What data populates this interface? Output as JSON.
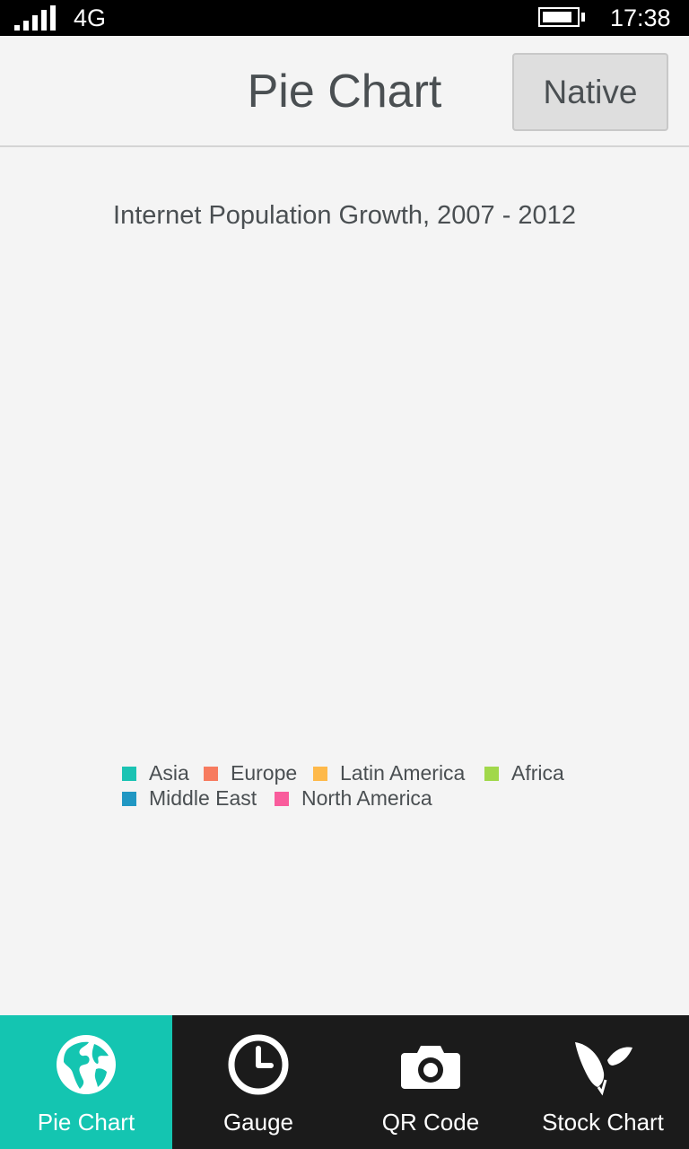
{
  "status_bar": {
    "network": "4G",
    "time": "17:38",
    "signal_bars": 5,
    "battery_level": 0.75
  },
  "header": {
    "title": "Pie Chart",
    "native_button": "Native"
  },
  "chart_data": {
    "type": "pie",
    "title": "Internet Population Growth, 2007 - 2012",
    "legend_position": "bottom",
    "series": [
      {
        "name": "Asia",
        "color": "#1bc3b3"
      },
      {
        "name": "Europe",
        "color": "#f77b5f"
      },
      {
        "name": "Latin America",
        "color": "#feb94a"
      },
      {
        "name": "Africa",
        "color": "#a1d84b"
      },
      {
        "name": "Middle East",
        "color": "#2097c3"
      },
      {
        "name": "North America",
        "color": "#f95c9c"
      }
    ],
    "values": []
  },
  "bottom_nav": {
    "items": [
      {
        "label": "Pie Chart",
        "icon": "globe-icon",
        "active": true
      },
      {
        "label": "Gauge",
        "icon": "clock-icon",
        "active": false
      },
      {
        "label": "QR Code",
        "icon": "camera-icon",
        "active": false
      },
      {
        "label": "Stock Chart",
        "icon": "leaf-icon",
        "active": false
      }
    ]
  },
  "colors": {
    "accent": "#14c5b1",
    "nav_background": "#1b1b1b",
    "text": "#4a4f52"
  }
}
